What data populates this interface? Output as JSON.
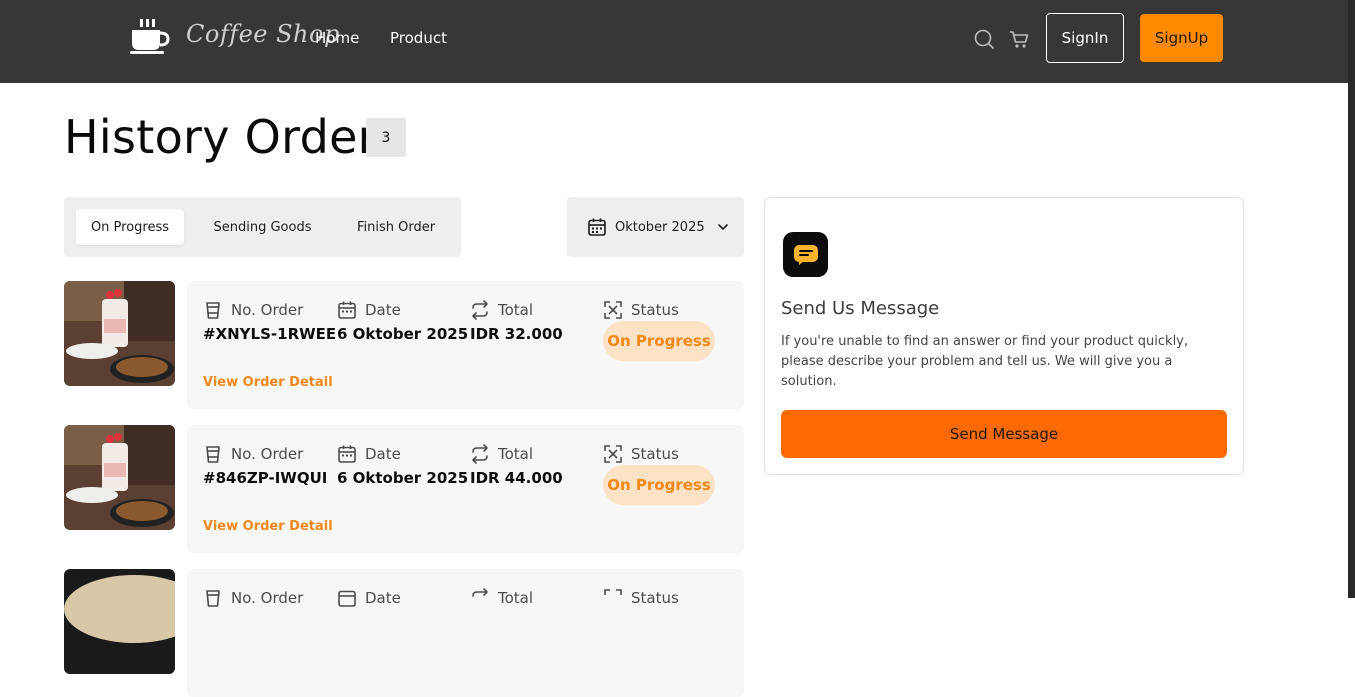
{
  "navbar": {
    "brand": "Coffee Shop",
    "links": [
      "Home",
      "Product"
    ],
    "signin_label": "SignIn",
    "signup_label": "SignUp",
    "icons": [
      "search-icon",
      "cart-icon"
    ]
  },
  "page": {
    "title": "History Order",
    "count": "3"
  },
  "tabs": [
    {
      "label": "On Progress",
      "active": true
    },
    {
      "label": "Sending Goods",
      "active": false
    },
    {
      "label": "Finish Order",
      "active": false
    }
  ],
  "month_filter": {
    "value": "Oktober 2025"
  },
  "order_fields": {
    "order_no": "No. Order",
    "date": "Date",
    "total": "Total",
    "status": "Status",
    "view_detail": "View Order Detail"
  },
  "orders": [
    {
      "order_no": "#XNYLS-1RWEE",
      "date": "6 Oktober 2025",
      "total": "IDR 32.000",
      "status": "On Progress"
    },
    {
      "order_no": "#846ZP-IWQUI",
      "date": "6 Oktober 2025",
      "total": "IDR 44.000",
      "status": "On Progress"
    },
    {
      "order_no": "",
      "date": "",
      "total": "",
      "status": ""
    }
  ],
  "message_panel": {
    "title": "Send Us Message",
    "description": "If you're unable to find an answer or find your product quickly, please describe your problem and tell us. We will give you a solution.",
    "button_label": "Send Message"
  },
  "colors": {
    "navbar": "#393636",
    "accent": "#ff8a00",
    "send_button": "#ff6a00",
    "status_bg": "#fde3c6",
    "status_text": "#f2871a"
  }
}
